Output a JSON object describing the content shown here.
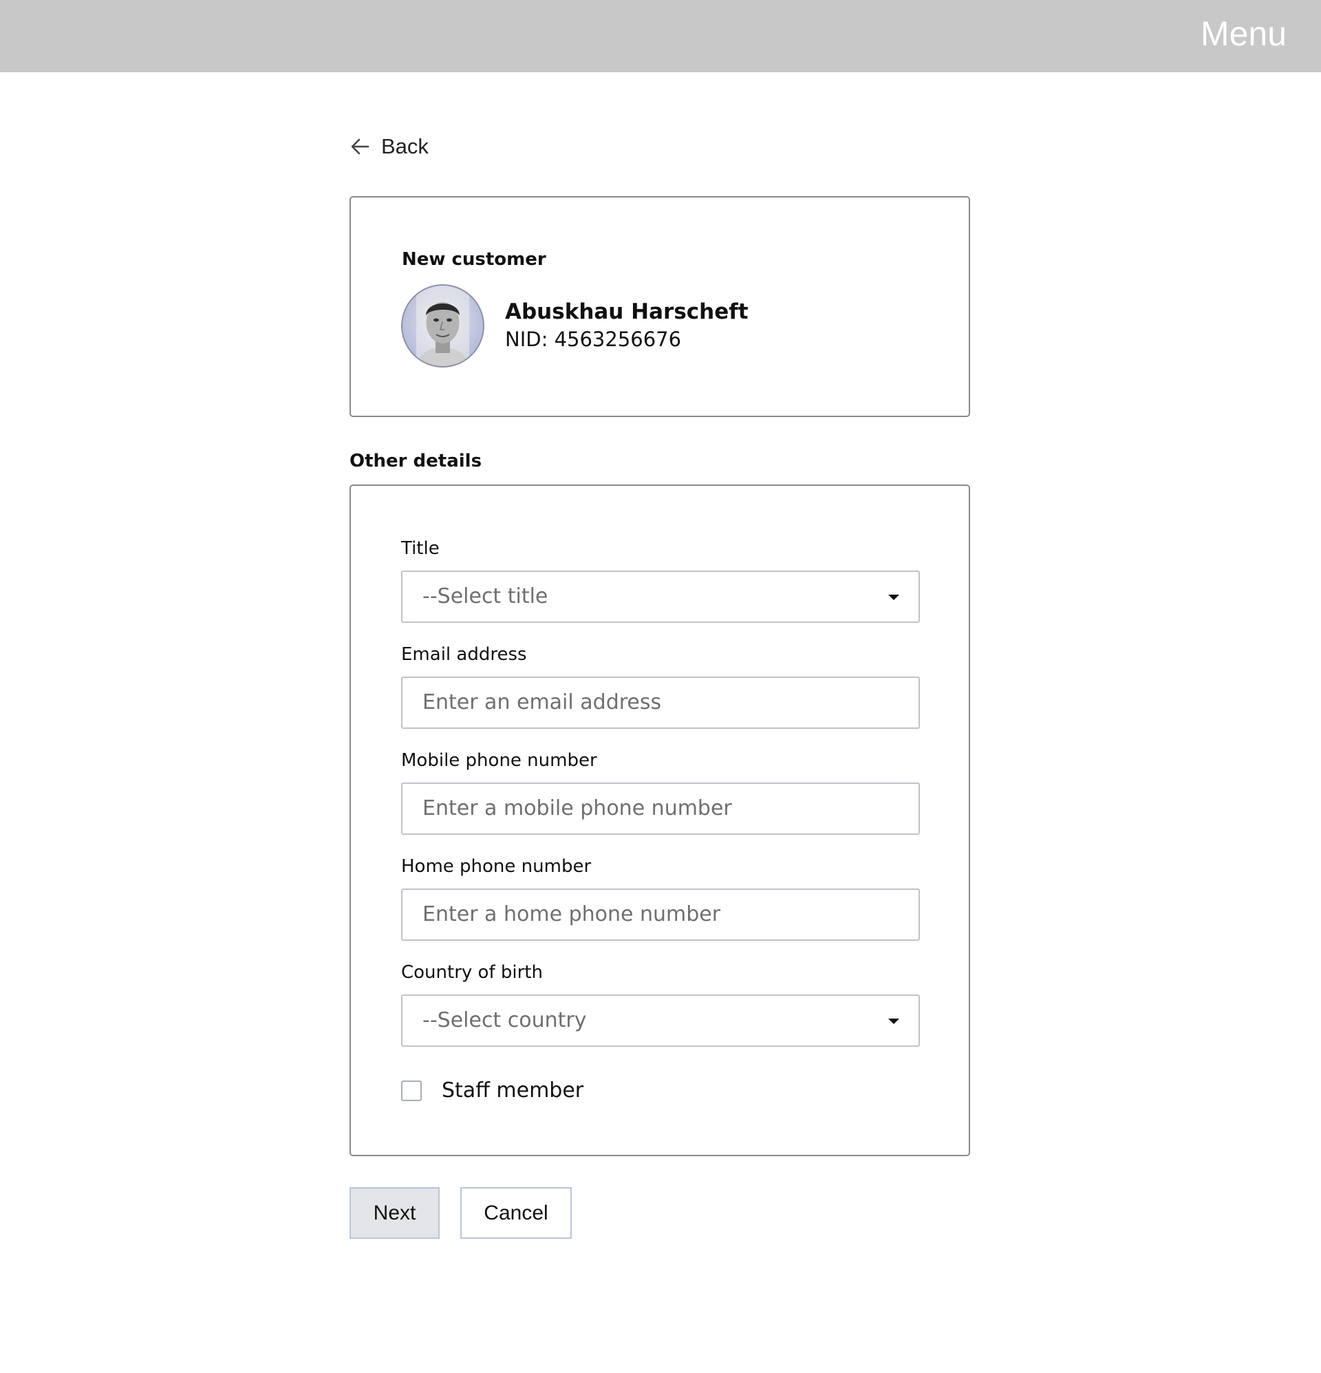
{
  "header": {
    "menu_label": "Menu",
    "background_color": "#c8c8c8"
  },
  "back": {
    "label": "Back",
    "icon": "arrow-left-icon"
  },
  "customer_card": {
    "heading": "New customer",
    "name": "Abuskhau Harscheft",
    "nid": "NID: 4563256676"
  },
  "other_details": {
    "heading": "Other details",
    "fields": {
      "title": {
        "label": "Title",
        "placeholder": "--Select title"
      },
      "email": {
        "label": "Email address",
        "placeholder": "Enter an email address"
      },
      "mobile": {
        "label": "Mobile phone number",
        "placeholder": "Enter a mobile phone number"
      },
      "home": {
        "label": "Home phone number",
        "placeholder": "Enter a home phone number"
      },
      "country": {
        "label": "Country of birth",
        "placeholder": "--Select country"
      }
    },
    "staff_member": {
      "label": "Staff member",
      "checked": false
    }
  },
  "actions": {
    "next_label": "Next",
    "cancel_label": "Cancel"
  }
}
